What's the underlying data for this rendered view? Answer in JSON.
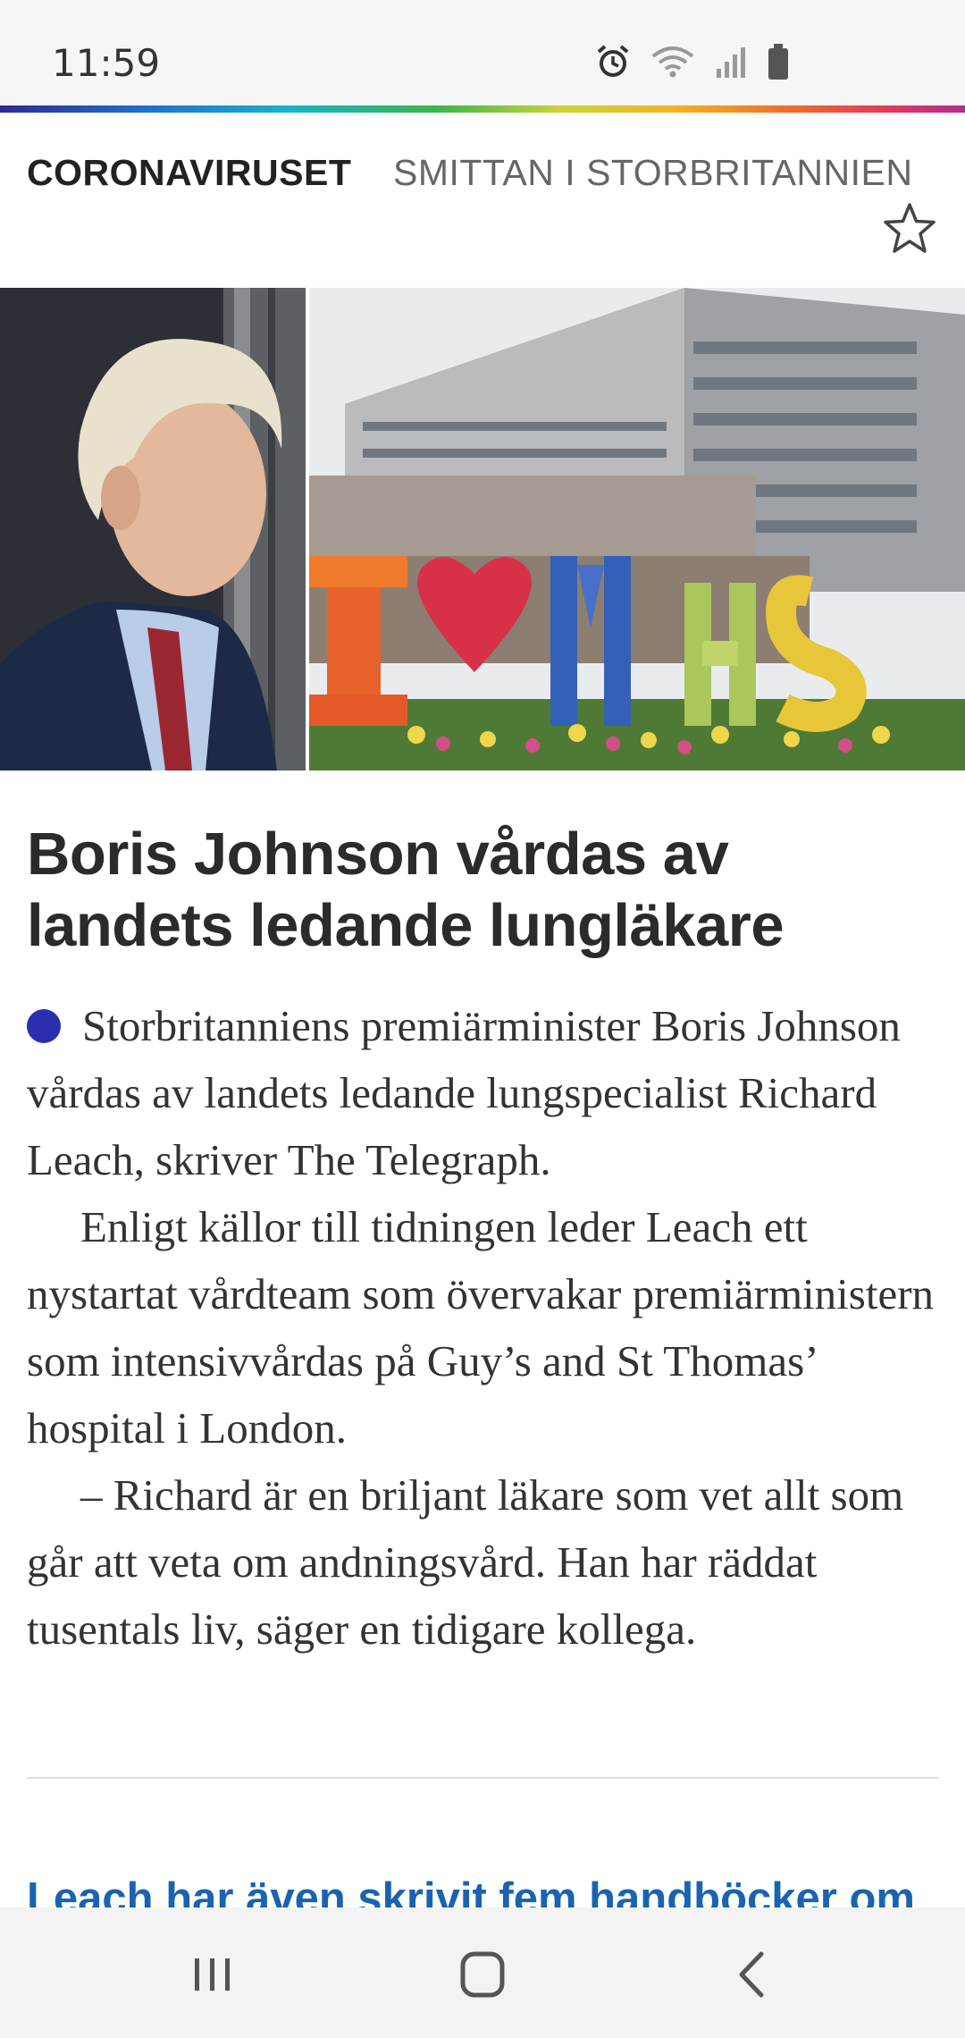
{
  "status_bar": {
    "time": "11:59"
  },
  "section": {
    "tag": "CORONAVIRUSET",
    "subtitle": "SMITTAN I STORBRITANNIEN"
  },
  "article": {
    "headline": "Boris Johnson vårdas av landets ledande lungläkare",
    "paragraphs": [
      "Storbritanniens premiärminister Boris Johnson vårdas av landets ledande lungspecialist Richard Leach, skriver The Telegraph.",
      "Enligt källor till tidningen leder Leach ett nystartat vårdteam som övervakar premiärministern som intensivvårdas på Guy’s and St Thomas’ hospital i London.",
      "– Richard är en briljant läkare som vet allt som går att veta om andningsvård. Han har räddat tusentals liv, säger en tidigare kollega."
    ],
    "link_text": "Leach har även skrivit fem handböcker om"
  },
  "colors": {
    "accent_dot": "#2a2fb0",
    "link": "#1a63b0"
  },
  "icons": [
    "alarm-icon",
    "wifi-icon",
    "signal-icon",
    "battery-icon",
    "star-icon",
    "recent-apps-icon",
    "home-icon",
    "back-icon"
  ]
}
